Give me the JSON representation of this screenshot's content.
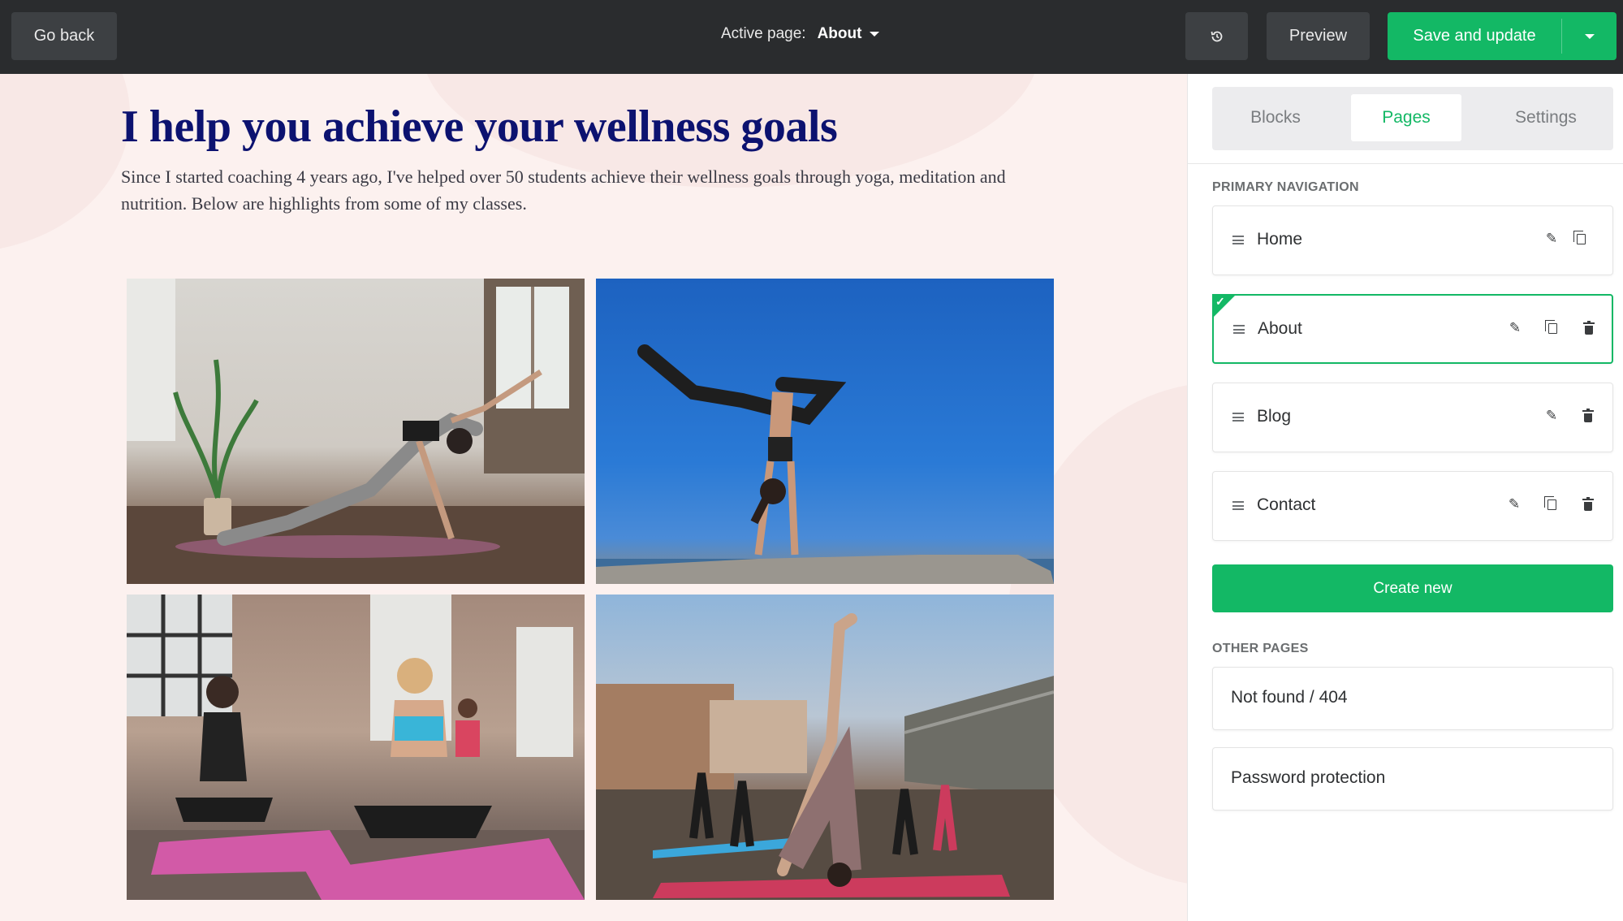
{
  "topbar": {
    "go_back": "Go back",
    "active_page_label": "Active page:",
    "active_page_value": "About",
    "preview": "Preview",
    "save": "Save and update",
    "history_icon": "history-icon"
  },
  "canvas": {
    "title": "I help you achieve your wellness goals",
    "text": "Since I started coaching 4 years ago, I've helped over 50 students achieve their wellness goals through yoga, meditation and nutrition.  Below are highlights from some of my classes.",
    "photos": [
      "yoga-stretch-photo",
      "handstand-photo",
      "meditation-class-photo",
      "rooftop-yoga-photo"
    ]
  },
  "panel": {
    "tabs": [
      "Blocks",
      "Pages",
      "Settings"
    ],
    "active_tab": "Pages",
    "primary_nav_title": "PRIMARY NAVIGATION",
    "primary_nav": [
      {
        "label": "Home"
      },
      {
        "label": "About",
        "active": true
      },
      {
        "label": "Blog"
      },
      {
        "label": "Contact"
      }
    ],
    "create_new": "Create new",
    "other_pages_title": "OTHER PAGES",
    "other_pages": [
      "Not found / 404",
      "Password protection"
    ]
  },
  "colors": {
    "accent": "#13b865",
    "topbar": "#2a2c2e",
    "title": "#0c1270",
    "canvas_bg": "#fcf1ef"
  }
}
